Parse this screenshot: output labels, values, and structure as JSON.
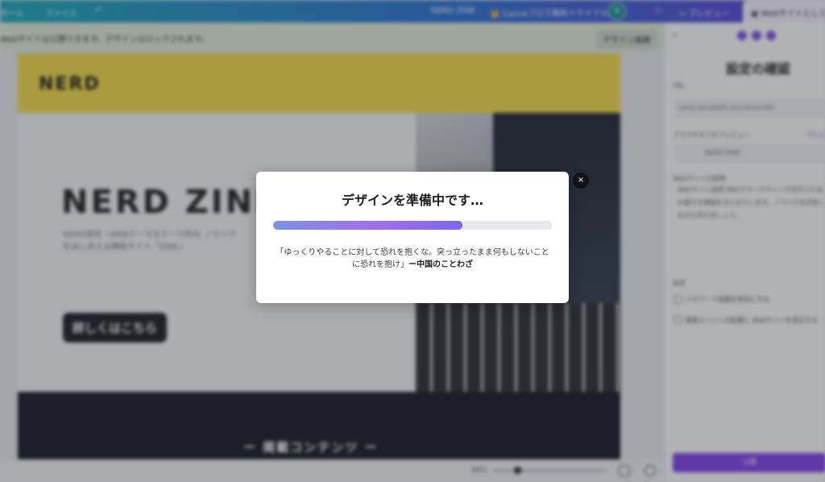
{
  "topbar": {
    "home": "ホーム",
    "file": "ファイル",
    "doc_title": "NERD ZINE",
    "pro_trial": "Canvaプロで無料トライアル",
    "avatar": "長",
    "preview": "プレビュー",
    "publish": "Webサイトとして公開"
  },
  "notice": {
    "text": "Webサイトは公開できます。デザインはロックされます。",
    "button": "デザイン編集"
  },
  "page": {
    "logo_small": "NERD",
    "brand": "NERD ZINE",
    "subtitle": "NERD部井・WEBテーマをテーマ的な ノウハウを出しあえる機能サイト「ZINE」",
    "cta": "詳しくはこちら",
    "section_title": "ー 掲載コンテンツ ー"
  },
  "bottombar": {
    "zoom": "68%"
  },
  "panel": {
    "heading": "設定の確認",
    "url_label": "URL",
    "url_value": "nerd-sample01.my.canva.site",
    "preview_label": "ブラウザタブのプレビュー",
    "preview_link": "プレビュー",
    "tab_title": "NERD ZINE",
    "desc_label": "Webサイトの説明",
    "desc_text": "Webサイト説明 Webでマーケティングを行うための様々な情報をまとめています。ノウハウを共有しながら学びましょう。",
    "options_label": "設定",
    "opt1": "パスワード保護を有効にする",
    "opt2": "検索エンジンの結果に Webサイトを表示する",
    "submit": "公開"
  },
  "modal": {
    "title": "デザインを準備中です…",
    "progress_percent": 68,
    "quote": "「ゆっくりやることに対して恐れを抱くな。突っ立ったまま何もしないことに恐れを抱け」",
    "quote_source": "ー中国のことわざ",
    "close_label": "×"
  },
  "colors": {
    "accent": "#7b3fe4",
    "progress_start": "#7b92e6",
    "progress_end": "#a36fe8"
  }
}
